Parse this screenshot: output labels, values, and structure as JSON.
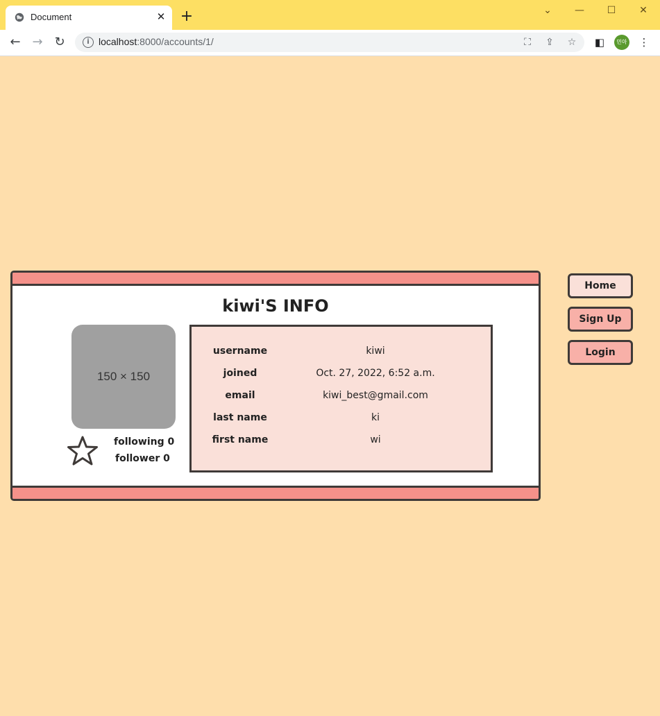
{
  "browser": {
    "tab_title": "Document",
    "url_host": "localhost",
    "url_path": ":8000/accounts/1/",
    "profile_label": "민아"
  },
  "colors": {
    "page_bg": "#fedeac",
    "band": "#f5918a",
    "info_bg": "#fae0d9",
    "home_btn": "#fae0d9",
    "nav_btn": "#f8b0a8"
  },
  "card": {
    "title": "kiwi'S INFO",
    "avatar_placeholder": "150 × 150",
    "following_label": "following",
    "following_count": "0",
    "follower_label": "follower",
    "follower_count": "0",
    "rows": [
      {
        "label": "username",
        "value": "kiwi"
      },
      {
        "label": "joined",
        "value": "Oct. 27, 2022, 6:52 a.m."
      },
      {
        "label": "email",
        "value": "kiwi_best@gmail.com"
      },
      {
        "label": "last name",
        "value": "ki"
      },
      {
        "label": "first name",
        "value": "wi"
      }
    ]
  },
  "nav": {
    "home": "Home",
    "signup": "Sign Up",
    "login": "Login"
  }
}
